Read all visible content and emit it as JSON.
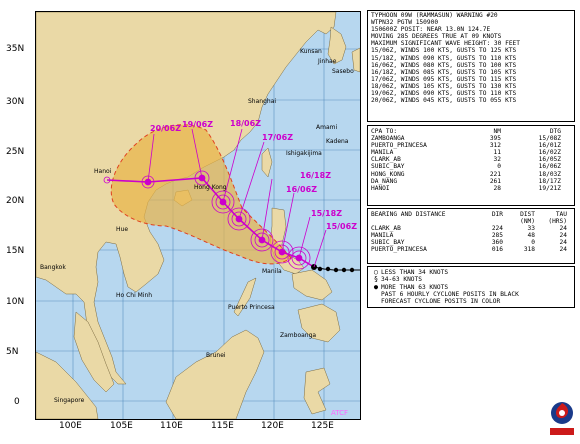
{
  "map": {
    "lat_labels": [
      "35N",
      "30N",
      "25N",
      "20N",
      "15N",
      "10N",
      "5N",
      "0"
    ],
    "lon_labels": [
      "100E",
      "105E",
      "110E",
      "115E",
      "120E",
      "125E"
    ],
    "places": {
      "kunsan": "Kunsan",
      "jinhae": "Jinhae",
      "sasebo": "Sasebo",
      "shanghai": "Shanghai",
      "amami": "Amami",
      "kadena": "Kadena",
      "ishigakijima": "Ishigakijima",
      "hong_kong": "Hong Kong",
      "hanoi": "Hanoi",
      "hue": "Hue",
      "bangkok": "Bangkok",
      "ho_chi_minh": "Ho Chi Minh",
      "manila": "Manila",
      "puerto_princesa": "Puerto Princesa",
      "zamboanga": "Zamboanga",
      "brunei": "Brunei",
      "singapore": "Singapore"
    },
    "forecast_labels": [
      "20/06Z",
      "19/06Z",
      "18/06Z",
      "17/06Z",
      "16/18Z",
      "16/06Z",
      "15/18Z",
      "15/06Z"
    ],
    "atcf_label": "ATCF",
    "track_color": "#cc00cc",
    "danger_area_color": "#e8b447"
  },
  "warning": {
    "lines": [
      "TYPHOON 09W (RAMMASUN) WARNING #20",
      "WTPN32 PGTW 150900",
      "150600Z POSIT: NEAR 13.0N 124.7E",
      "MOVING 285 DEGREES TRUE AT 09 KNOTS",
      "MAXIMUM SIGNIFICANT WAVE HEIGHT: 30 FEET",
      "15/06Z, WINDS 100 KTS, GUSTS TO 125 KTS",
      "15/18Z, WINDS 090 KTS, GUSTS TO 110 KTS",
      "16/06Z, WINDS 080 KTS, GUSTS TO 100 KTS",
      "16/18Z, WINDS 085 KTS, GUSTS TO 105 KTS",
      "17/06Z, WINDS 095 KTS, GUSTS TO 115 KTS",
      "18/06Z, WINDS 105 KTS, GUSTS TO 130 KTS",
      "19/06Z, WINDS 090 KTS, GUSTS TO 110 KTS",
      "20/06Z, WINDS 045 KTS, GUSTS TO 055 KTS"
    ]
  },
  "cpa": {
    "header": {
      "name": "CPA TO:",
      "nm": "NM",
      "dtg": "DTG"
    },
    "rows": [
      {
        "name": "ZAMBOANGA",
        "nm": "395",
        "dtg": "15/08Z"
      },
      {
        "name": "PUERTO_PRINCESA",
        "nm": "312",
        "dtg": "16/01Z"
      },
      {
        "name": "MANILA",
        "nm": "11",
        "dtg": "16/02Z"
      },
      {
        "name": "CLARK_AB",
        "nm": "32",
        "dtg": "16/05Z"
      },
      {
        "name": "SUBIC_BAY",
        "nm": "0",
        "dtg": "16/06Z"
      },
      {
        "name": "HONG_KONG",
        "nm": "221",
        "dtg": "18/03Z"
      },
      {
        "name": "DA_NANG",
        "nm": "261",
        "dtg": "18/17Z"
      },
      {
        "name": "HANOI",
        "nm": "28",
        "dtg": "19/21Z"
      }
    ]
  },
  "bearing": {
    "header": {
      "name": "BEARING AND DISTANCE",
      "dir": "DIR",
      "dist": "DIST",
      "tau": "TAU"
    },
    "subheader": {
      "dist": "(NM)",
      "tau": "(HRS)"
    },
    "rows": [
      {
        "name": "CLARK_AB",
        "dir": "224",
        "dist": "33",
        "tau": "24"
      },
      {
        "name": "MANILA",
        "dir": "285",
        "dist": "48",
        "tau": "24"
      },
      {
        "name": "SUBIC_BAY",
        "dir": "360",
        "dist": "0",
        "tau": "24"
      },
      {
        "name": "PUERTO_PRINCESA",
        "dir": "016",
        "dist": "318",
        "tau": "24"
      }
    ]
  },
  "legend": {
    "items": [
      {
        "symbol": "○",
        "text": "LESS THAN 34 KNOTS"
      },
      {
        "symbol": "§",
        "text": "34-63 KNOTS"
      },
      {
        "symbol": "●",
        "text": "MORE THAN 63 KNOTS"
      },
      {
        "symbol": "",
        "text": "PAST 6 HOURLY CYCLONE POSITS IN BLACK"
      },
      {
        "symbol": "",
        "text": "FORECAST CYCLONE POSITS IN COLOR"
      }
    ]
  }
}
